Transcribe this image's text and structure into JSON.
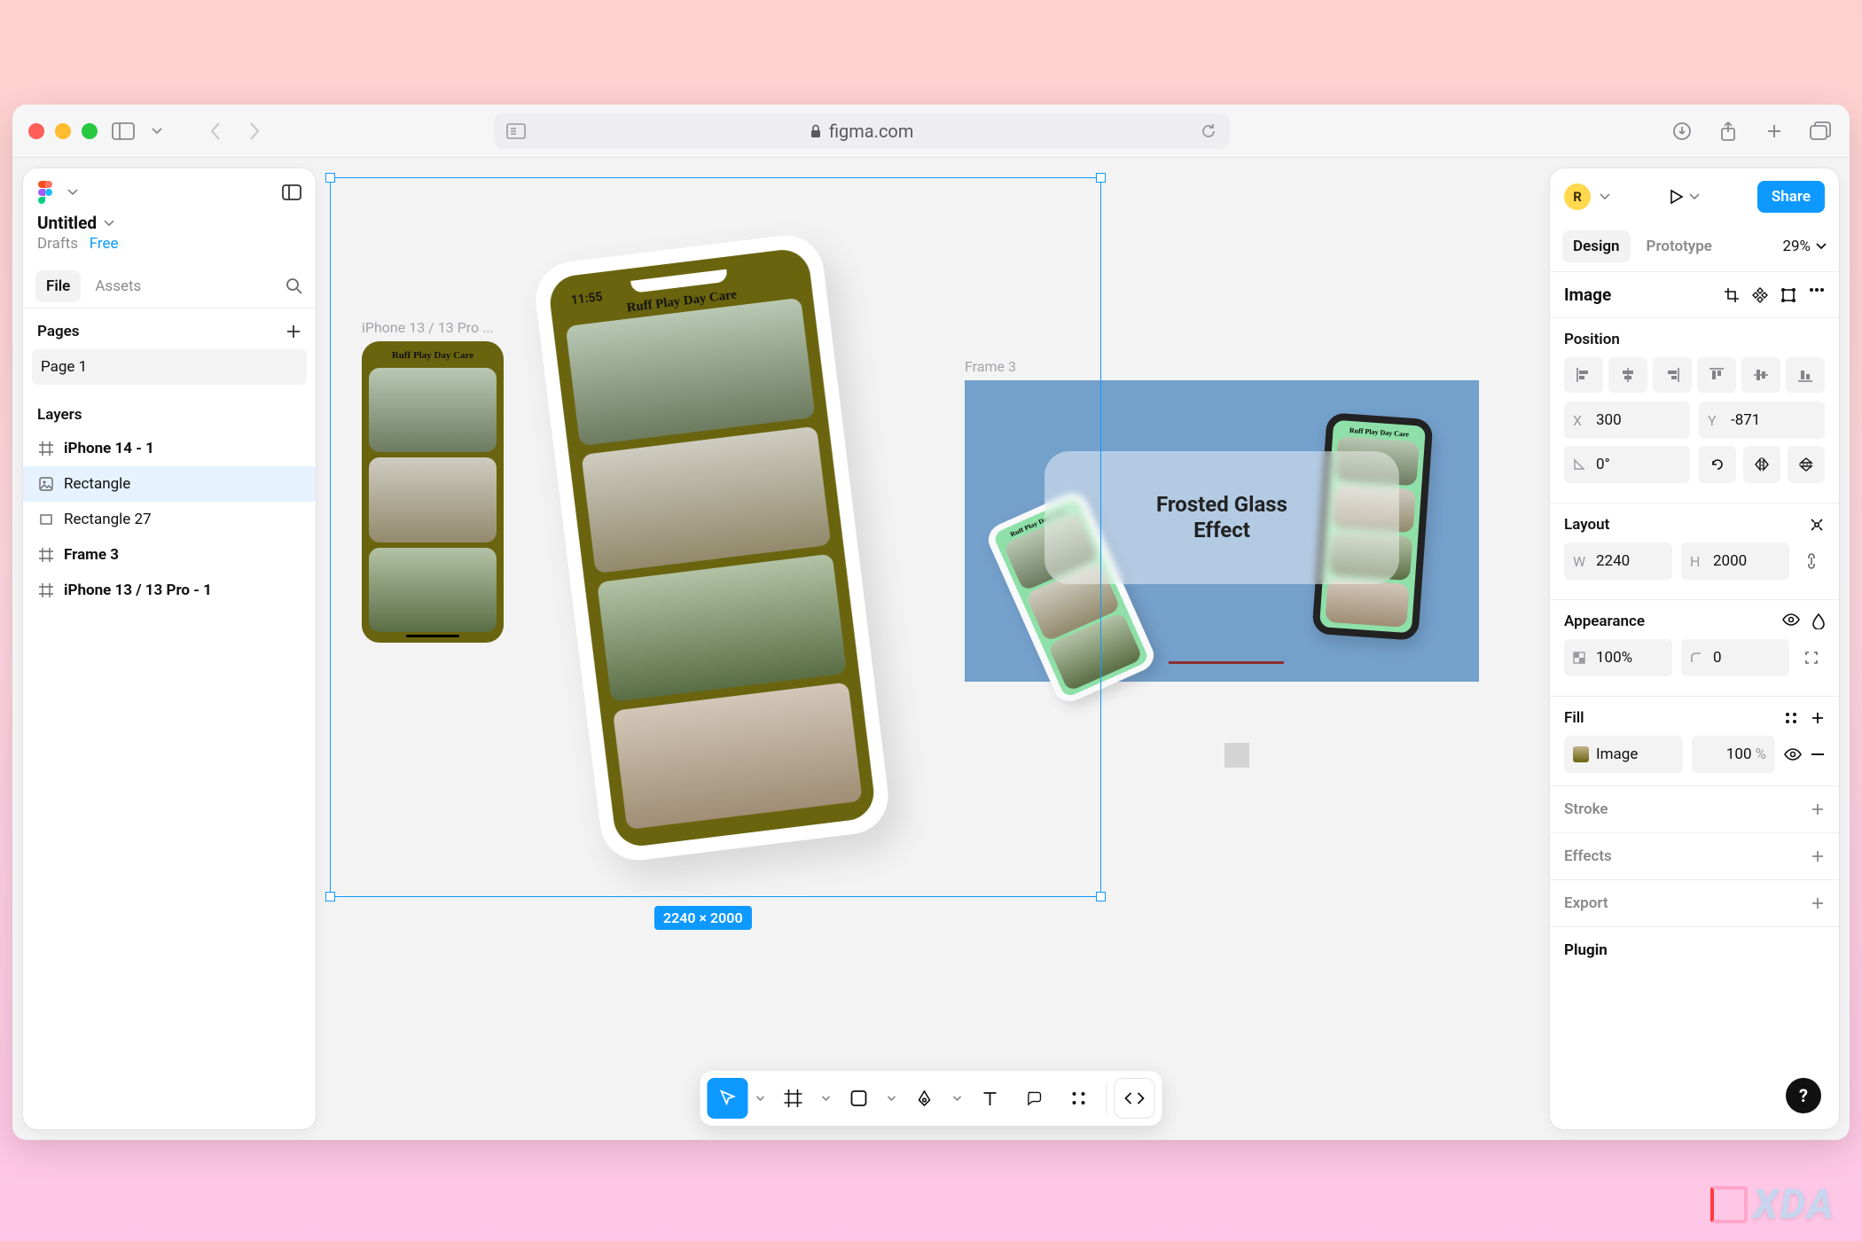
{
  "browser": {
    "url_host": "figma.com"
  },
  "file": {
    "title": "Untitled",
    "location": "Drafts",
    "plan": "Free"
  },
  "left_panel": {
    "tabs": {
      "file": "File",
      "assets": "Assets"
    },
    "pages_header": "Pages",
    "page1": "Page 1",
    "layers_header": "Layers",
    "layers": [
      {
        "name": "iPhone 14 - 1",
        "icon": "frame",
        "bold": true
      },
      {
        "name": "Rectangle",
        "icon": "image",
        "selected": true
      },
      {
        "name": "Rectangle 27",
        "icon": "rect"
      },
      {
        "name": "Frame 3",
        "icon": "frame",
        "bold": true
      },
      {
        "name": "iPhone 13 / 13 Pro - 1",
        "icon": "frame",
        "bold": true
      }
    ]
  },
  "right_panel": {
    "avatar": "R",
    "share": "Share",
    "tabs": {
      "design": "Design",
      "prototype": "Prototype"
    },
    "zoom": "29%",
    "section_image": "Image",
    "position": {
      "label": "Position",
      "x_label": "X",
      "x": "300",
      "y_label": "Y",
      "y": "-871",
      "rotation": "0°"
    },
    "layout": {
      "label": "Layout",
      "w_label": "W",
      "w": "2240",
      "h_label": "H",
      "h": "2000"
    },
    "appearance": {
      "label": "Appearance",
      "opacity": "100%",
      "radius": "0"
    },
    "fill": {
      "label": "Fill",
      "type": "Image",
      "pct": "100",
      "pct_sym": "%"
    },
    "stroke": "Stroke",
    "effects": "Effects",
    "export": "Export",
    "plugin": "Plugin"
  },
  "canvas": {
    "iphone13_label": "iPhone 13 / 13 Pro ...",
    "frame3_label": "Frame 3",
    "app_title": "Ruff Play Day Care",
    "phone_time": "11:55",
    "frosted_text": "Frosted Glass\nEffect",
    "selection_dims": "2240 × 2000"
  },
  "watermark": "XDA"
}
